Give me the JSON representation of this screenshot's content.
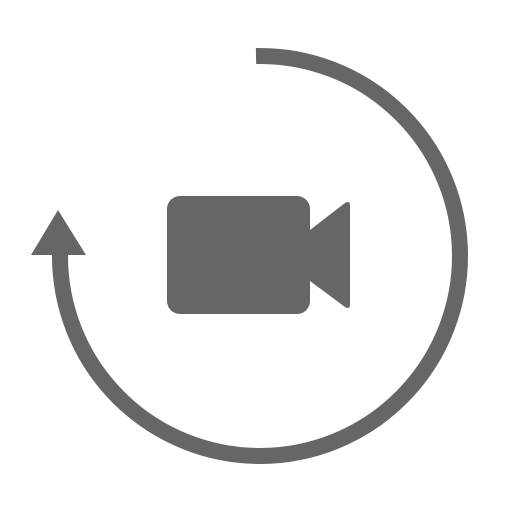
{
  "icon": {
    "name": "rotate-video-icon",
    "parts": [
      "circular-arrow-icon",
      "video-camera-icon"
    ],
    "color": "#666666",
    "background": "#ffffff"
  }
}
